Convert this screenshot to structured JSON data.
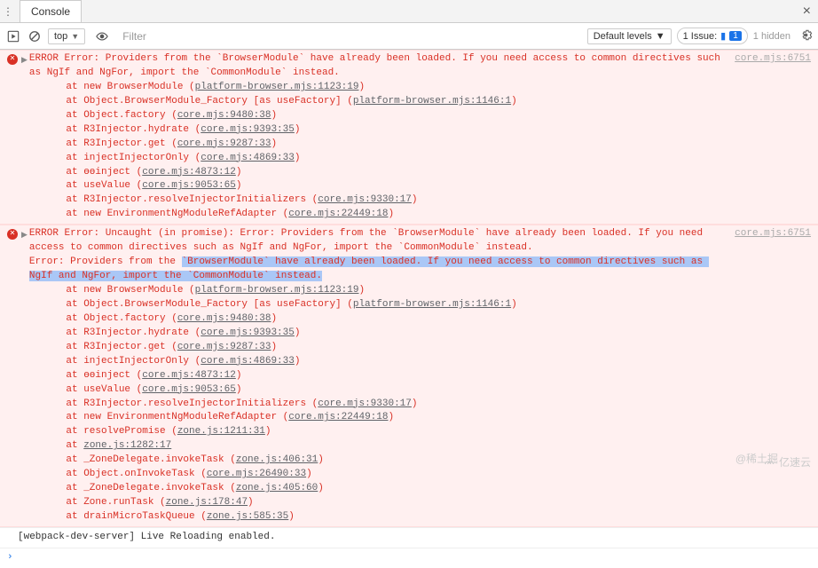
{
  "tab": {
    "label": "Console"
  },
  "toolbar": {
    "context": "top",
    "filter_placeholder": "Filter",
    "levels": "Default levels",
    "issues_label": "1 Issue:",
    "issues_badge": "1",
    "hidden": "1 hidden"
  },
  "errors": [
    {
      "header": "ERROR Error: Providers from the `BrowserModule` have already been loaded. If you need access to common directives such as NgIf and NgFor, import the `CommonModule` instead.",
      "source": "core.mjs:6751",
      "stack": [
        {
          "pre": "at new BrowserModule (",
          "link": "platform-browser.mjs:1123:19",
          "post": ")"
        },
        {
          "pre": "at Object.BrowserModule_Factory [as useFactory] (",
          "link": "platform-browser.mjs:1146:1",
          "post": ")"
        },
        {
          "pre": "at Object.factory (",
          "link": "core.mjs:9480:38",
          "post": ")"
        },
        {
          "pre": "at R3Injector.hydrate (",
          "link": "core.mjs:9393:35",
          "post": ")"
        },
        {
          "pre": "at R3Injector.get (",
          "link": "core.mjs:9287:33",
          "post": ")"
        },
        {
          "pre": "at injectInjectorOnly (",
          "link": "core.mjs:4869:33",
          "post": ")"
        },
        {
          "pre": "at ɵɵinject (",
          "link": "core.mjs:4873:12",
          "post": ")"
        },
        {
          "pre": "at useValue (",
          "link": "core.mjs:9053:65",
          "post": ")"
        },
        {
          "pre": "at R3Injector.resolveInjectorInitializers (",
          "link": "core.mjs:9330:17",
          "post": ")"
        },
        {
          "pre": "at new EnvironmentNgModuleRefAdapter (",
          "link": "core.mjs:22449:18",
          "post": ")"
        }
      ]
    },
    {
      "header_pre": "ERROR Error: Uncaught (in promise): Error: Providers from the `BrowserModule` have already been loaded. If you need access to common directives such as NgIf and NgFor, import the `CommonModule` instead.\nError: Providers from the ",
      "header_hl": "`BrowserModule` have already been loaded. If you need access to common directives such as NgIf and NgFor, import the `CommonModule` instead.",
      "source": "core.mjs:6751",
      "stack": [
        {
          "pre": "at new BrowserModule (",
          "link": "platform-browser.mjs:1123:19",
          "post": ")"
        },
        {
          "pre": "at Object.BrowserModule_Factory [as useFactory] (",
          "link": "platform-browser.mjs:1146:1",
          "post": ")"
        },
        {
          "pre": "at Object.factory (",
          "link": "core.mjs:9480:38",
          "post": ")"
        },
        {
          "pre": "at R3Injector.hydrate (",
          "link": "core.mjs:9393:35",
          "post": ")"
        },
        {
          "pre": "at R3Injector.get (",
          "link": "core.mjs:9287:33",
          "post": ")"
        },
        {
          "pre": "at injectInjectorOnly (",
          "link": "core.mjs:4869:33",
          "post": ")"
        },
        {
          "pre": "at ɵɵinject (",
          "link": "core.mjs:4873:12",
          "post": ")"
        },
        {
          "pre": "at useValue (",
          "link": "core.mjs:9053:65",
          "post": ")"
        },
        {
          "pre": "at R3Injector.resolveInjectorInitializers (",
          "link": "core.mjs:9330:17",
          "post": ")"
        },
        {
          "pre": "at new EnvironmentNgModuleRefAdapter (",
          "link": "core.mjs:22449:18",
          "post": ")"
        },
        {
          "pre": "at resolvePromise (",
          "link": "zone.js:1211:31",
          "post": ")"
        },
        {
          "pre": "at ",
          "link": "zone.js:1282:17",
          "post": ""
        },
        {
          "pre": "at _ZoneDelegate.invokeTask (",
          "link": "zone.js:406:31",
          "post": ")"
        },
        {
          "pre": "at Object.onInvokeTask (",
          "link": "core.mjs:26490:33",
          "post": ")"
        },
        {
          "pre": "at _ZoneDelegate.invokeTask (",
          "link": "zone.js:405:60",
          "post": ")"
        },
        {
          "pre": "at Zone.runTask (",
          "link": "zone.js:178:47",
          "post": ")"
        },
        {
          "pre": "at drainMicroTaskQueue (",
          "link": "zone.js:585:35",
          "post": ")"
        }
      ]
    }
  ],
  "log": {
    "text": "[webpack-dev-server] Live Reloading enabled."
  },
  "prompt": "›",
  "watermark": "@稀土掘",
  "watermark2": "亿速云"
}
